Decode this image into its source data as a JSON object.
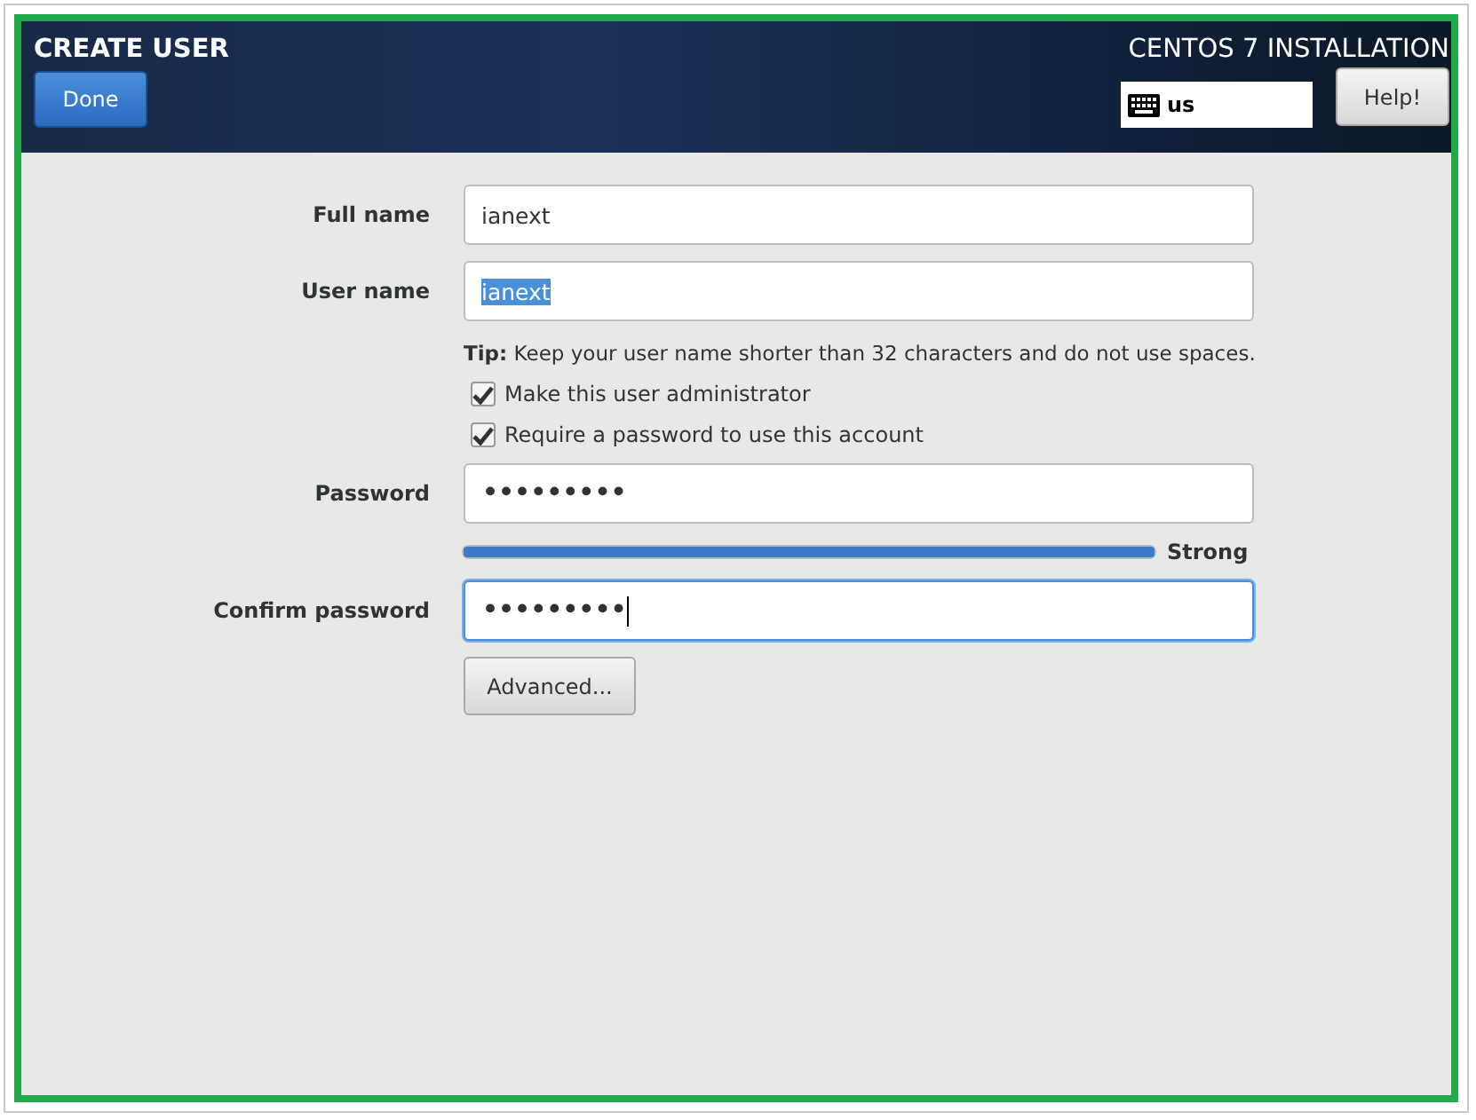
{
  "header": {
    "title": "CREATE USER",
    "done_button": "Done",
    "product": "CENTOS 7 INSTALLATION",
    "keyboard_layout": "us",
    "help_button": "Help!"
  },
  "form": {
    "full_name": {
      "label": "Full name",
      "value": "ianext",
      "focused": false,
      "selected_text": false
    },
    "user_name": {
      "label": "User name",
      "value": "ianext",
      "focused": false,
      "selected_text": true
    },
    "tip": "**Tip:** Keep your user name shorter than 32 characters and do not use spaces.",
    "checkboxes": [
      {
        "label": "Make this user administrator",
        "checked": true
      },
      {
        "label": "Require a password to use this account",
        "checked": true
      }
    ],
    "password": {
      "label": "Password",
      "value": "•••••••••",
      "focused": false,
      "selected_text": false
    },
    "strength": {
      "level": 1,
      "reading": "Strong"
    },
    "confirm_password": {
      "label": "Confirm password",
      "value": "•••••••••",
      "focused": true,
      "selected_text": false
    },
    "advanced_button": "Advanced..."
  }
}
